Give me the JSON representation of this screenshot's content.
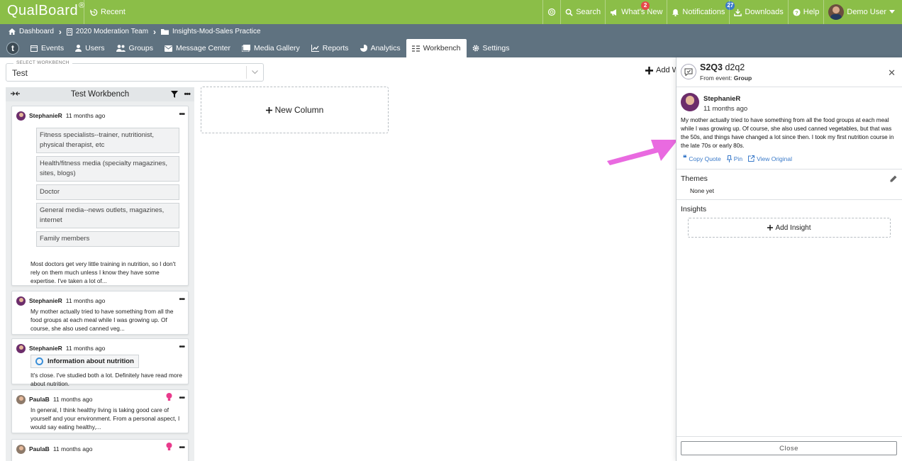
{
  "app": {
    "name": "QualBoard",
    "trademark": "®"
  },
  "topbar": {
    "recent": "Recent",
    "search": "Search",
    "whats_new": "What's New",
    "whats_new_badge": "2",
    "notifications": "Notifications",
    "notifications_badge": "27",
    "downloads": "Downloads",
    "help": "Help",
    "user": "Demo User"
  },
  "breadcrumb": [
    "Dashboard",
    "2020 Moderation Team",
    "Insights-Mod-Sales Practice"
  ],
  "nav": {
    "logo": "t",
    "items": [
      "Events",
      "Users",
      "Groups",
      "Message Center",
      "Media Gallery",
      "Reports",
      "Analytics",
      "Workbench",
      "Settings"
    ],
    "active": "Workbench"
  },
  "workbench": {
    "select_label": "SELECT WORKBENCH",
    "selected": "Test",
    "add_label": "Add W",
    "column_title": "Test Workbench",
    "new_column": "New Column"
  },
  "cards": [
    {
      "user": "StephanieR",
      "time": "11 months ago",
      "options": [
        "Fitness specialists--trainer, nutritionist, physical therapist, etc",
        "Health/fitness media (specialty magazines, sites, blogs)",
        "Doctor",
        "General media--news outlets, magazines, internet",
        "Family members"
      ],
      "text": "Most doctors get very little training in nutrition, so I don't rely on them much unless I know they have some expertise. I've taken a lot of..."
    },
    {
      "user": "StephanieR",
      "time": "11 months ago",
      "text": "My mother actually tried to have something from all the food groups at each meal while I was growing up. Of course, she also used canned veg..."
    },
    {
      "user": "StephanieR",
      "time": "11 months ago",
      "chip": "Information about nutrition",
      "text": "It's close. I've studied both a lot. Definitely have read more about nutrition."
    },
    {
      "user": "PaulaB",
      "time": "11 months ago",
      "text": "In general, I think healthy living is taking good care of yourself and your environment. From a personal aspect, I would say eating healthy,..."
    },
    {
      "user": "PaulaB",
      "time": "11 months ago",
      "text": ""
    }
  ],
  "panel": {
    "title_bold": "S2Q3",
    "title_rest": "d2q2",
    "from_prefix": "From event:",
    "from_event": "Group",
    "user": "StephanieR",
    "time": "11 months ago",
    "text": "My mother actually tried to have something from all the food groups at each meal while I was growing up. Of course, she also used canned vegetables, but that was the 50s, and things have changed a lot since then. I took my first nutrition course in the late 70s or early 80s.",
    "copy_quote": "Copy Quote",
    "pin": "Pin",
    "view_original": "View Original",
    "themes_title": "Themes",
    "themes_value": "None yet",
    "insights_title": "Insights",
    "add_insight": "Add Insight",
    "close": "Close"
  },
  "colors": {
    "brand_green": "#8bbe48",
    "nav_gray": "#5f7280",
    "link_blue": "#3a7ac9",
    "arrow_pink": "#e96ae0"
  }
}
